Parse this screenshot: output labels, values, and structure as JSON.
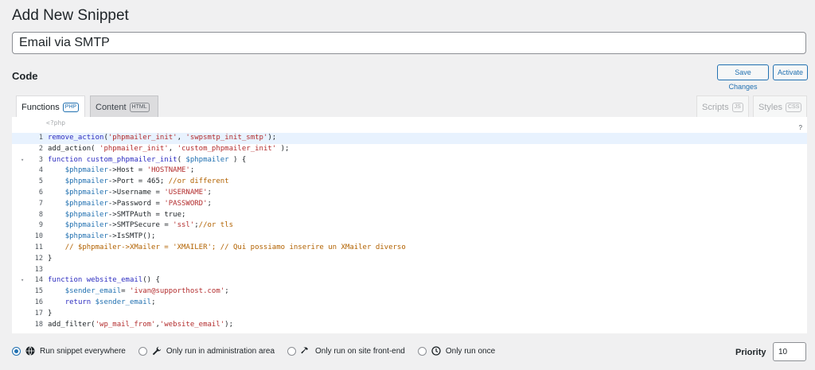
{
  "page": {
    "title": "Add New Snippet"
  },
  "snippet": {
    "title_value": "Email via SMTP"
  },
  "code_section": {
    "heading": "Code",
    "save_label": "Save Changes",
    "activate_label": "Activate"
  },
  "tabs": [
    {
      "label": "Functions",
      "badge": "PHP",
      "active": true
    },
    {
      "label": "Content",
      "badge": "HTML",
      "active": false
    },
    {
      "label": "Scripts",
      "badge": "JS",
      "active": false
    },
    {
      "label": "Styles",
      "badge": "CSS",
      "active": false
    }
  ],
  "editor": {
    "opening_hint": "<?php",
    "help_mark": "?",
    "active_line": 1,
    "fold_markers": [
      3,
      14
    ],
    "lines": [
      [
        [
          "k",
          "remove_action"
        ],
        [
          "d",
          "("
        ],
        [
          "s",
          "'phpmailer_init'"
        ],
        [
          "d",
          ", "
        ],
        [
          "s",
          "'swpsmtp_init_smtp'"
        ],
        [
          "d",
          ");"
        ]
      ],
      [
        [
          "d",
          "add_action( "
        ],
        [
          "s",
          "'phpmailer_init'"
        ],
        [
          "d",
          ", "
        ],
        [
          "s",
          "'custom_phpmailer_init'"
        ],
        [
          "d",
          " );"
        ]
      ],
      [
        [
          "k",
          "function custom_phpmailer_init"
        ],
        [
          "d",
          "( "
        ],
        [
          "v",
          "$phpmailer"
        ],
        [
          "d",
          " ) {"
        ]
      ],
      [
        [
          "d",
          "    "
        ],
        [
          "v",
          "$phpmailer"
        ],
        [
          "d",
          "->Host = "
        ],
        [
          "s",
          "'HOSTNAME'"
        ],
        [
          "d",
          ";"
        ]
      ],
      [
        [
          "d",
          "    "
        ],
        [
          "v",
          "$phpmailer"
        ],
        [
          "d",
          "->Port = 465; "
        ],
        [
          "c",
          "//or different"
        ]
      ],
      [
        [
          "d",
          "    "
        ],
        [
          "v",
          "$phpmailer"
        ],
        [
          "d",
          "->Username = "
        ],
        [
          "s",
          "'USERNAME'"
        ],
        [
          "d",
          ";"
        ]
      ],
      [
        [
          "d",
          "    "
        ],
        [
          "v",
          "$phpmailer"
        ],
        [
          "d",
          "->Password = "
        ],
        [
          "s",
          "'PASSWORD'"
        ],
        [
          "d",
          ";"
        ]
      ],
      [
        [
          "d",
          "    "
        ],
        [
          "v",
          "$phpmailer"
        ],
        [
          "d",
          "->SMTPAuth = true;"
        ]
      ],
      [
        [
          "d",
          "    "
        ],
        [
          "v",
          "$phpmailer"
        ],
        [
          "d",
          "->SMTPSecure = "
        ],
        [
          "s",
          "'ssl'"
        ],
        [
          "d",
          ";"
        ],
        [
          "c",
          "//or tls"
        ]
      ],
      [
        [
          "d",
          "    "
        ],
        [
          "v",
          "$phpmailer"
        ],
        [
          "d",
          "->IsSMTP();"
        ]
      ],
      [
        [
          "d",
          "    "
        ],
        [
          "c",
          "// $phpmailer->XMailer = 'XMAILER'; // Qui possiamo inserire un XMailer diverso"
        ]
      ],
      [
        [
          "d",
          "}"
        ]
      ],
      [
        [
          "d",
          ""
        ]
      ],
      [
        [
          "k",
          "function website_email"
        ],
        [
          "d",
          "() {"
        ]
      ],
      [
        [
          "d",
          "    "
        ],
        [
          "v",
          "$sender_email"
        ],
        [
          "d",
          "= "
        ],
        [
          "s",
          "'ivan@supporthost.com'"
        ],
        [
          "d",
          ";"
        ]
      ],
      [
        [
          "d",
          "    "
        ],
        [
          "k",
          "return "
        ],
        [
          "v",
          "$sender_email"
        ],
        [
          "d",
          ";"
        ]
      ],
      [
        [
          "d",
          "}"
        ]
      ],
      [
        [
          "d",
          "add_filter("
        ],
        [
          "s",
          "'wp_mail_from'"
        ],
        [
          "d",
          ","
        ],
        [
          "s",
          "'website_email'"
        ],
        [
          "d",
          ");"
        ]
      ]
    ]
  },
  "scope_options": [
    {
      "label": "Run snippet everywhere",
      "icon": "globe-icon",
      "checked": true
    },
    {
      "label": "Only run in administration area",
      "icon": "wrench-icon",
      "checked": false
    },
    {
      "label": "Only run on site front-end",
      "icon": "hammer-icon",
      "checked": false
    },
    {
      "label": "Only run once",
      "icon": "clock-icon",
      "checked": false
    }
  ],
  "priority": {
    "label": "Priority",
    "value": "10"
  }
}
